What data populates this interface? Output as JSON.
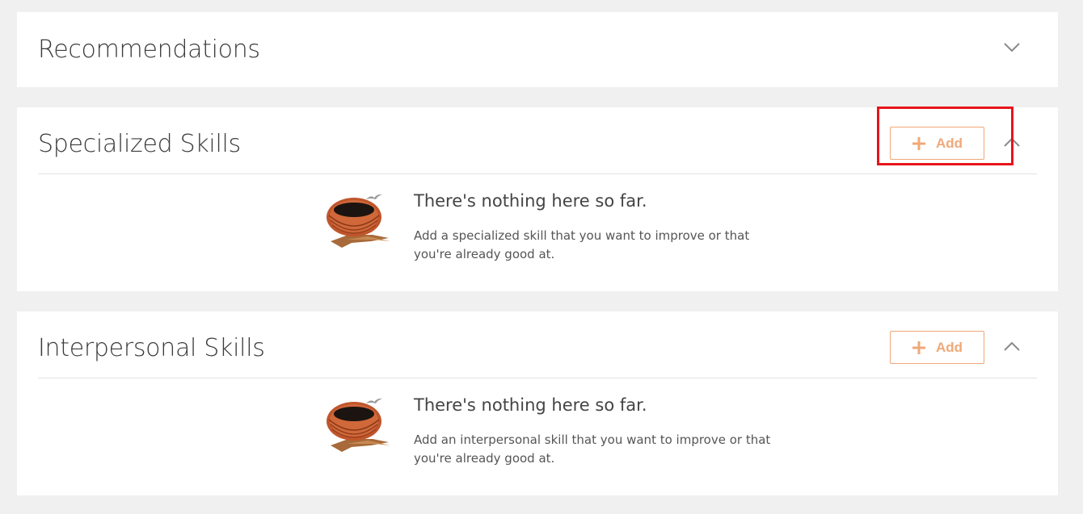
{
  "sections": {
    "recommendations": {
      "title": "Recommendations",
      "expanded": false
    },
    "specialized": {
      "title": "Specialized Skills",
      "add_label": "Add",
      "expanded": true,
      "empty_title": "There's nothing here so far.",
      "empty_text": "Add a specialized skill that you want to improve or that you're already good at."
    },
    "interpersonal": {
      "title": "Interpersonal Skills",
      "add_label": "Add",
      "expanded": true,
      "empty_title": "There's nothing here so far.",
      "empty_text": "Add an interpersonal skill that you want to improve or that you're already good at."
    }
  },
  "icons": {
    "collapsed": "chevron-down-icon",
    "expanded": "chevron-up-icon",
    "add": "plus-icon",
    "empty_state": "bird-nest-illustration"
  },
  "colors": {
    "accent": "#f0a878",
    "highlight": "#e8141b",
    "background": "#f0f0f0",
    "card": "#ffffff"
  }
}
